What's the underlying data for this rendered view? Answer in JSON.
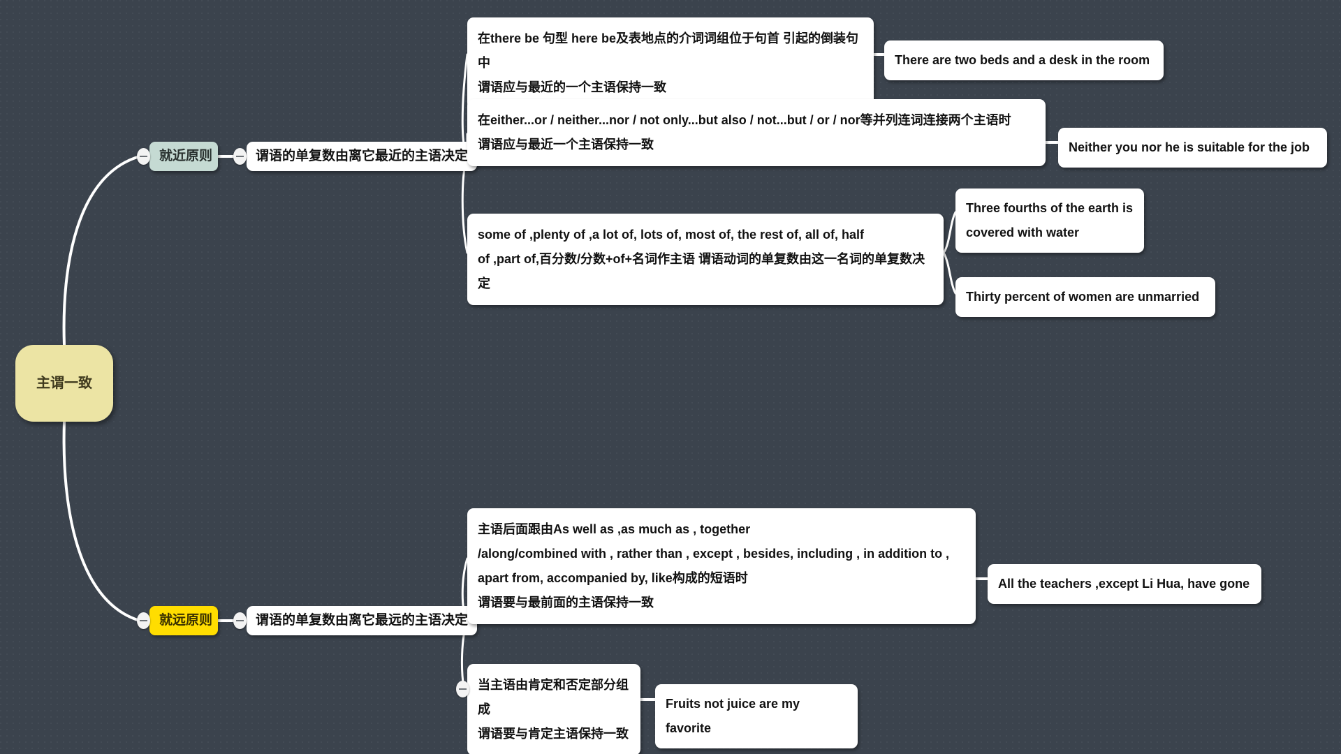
{
  "canvas": {
    "background_color": "#3b434d",
    "edge_color": "#ffffff"
  },
  "root": {
    "label": "主谓一致",
    "fill": "#ece4a4"
  },
  "branches": [
    {
      "label": "就近原则",
      "fill": "#c5dad3",
      "summary": "谓语的单复数由离它最近的主语决定",
      "details": [
        {
          "text": "在there be 句型 here be及表地点的介词词组位于句首 引起的倒装句中\n谓语应与最近的一个主语保持一致",
          "examples": [
            "There are two beds and a desk in the room"
          ]
        },
        {
          "text": "在either...or / neither...nor / not only...but also / not...but / or / nor等并列连词连接两个主语时\n谓语应与最近一个主语保持一致",
          "examples": [
            "Neither you nor he is suitable for the job"
          ]
        },
        {
          "text": "some of ,plenty of ,a lot of, lots of, most of, the rest of, all of, half\nof ,part of,百分数/分数+of+名词作主语 谓语动词的单复数由这一名词的单复数决定",
          "examples": [
            "Three fourths of the earth is\ncovered with water",
            "Thirty percent of women are unmarried"
          ]
        }
      ]
    },
    {
      "label": "就远原则",
      "fill": "#ffdd00",
      "summary": "谓语的单复数由离它最远的主语决定",
      "details": [
        {
          "text": "主语后面跟由As well as ,as much as , together\n/along/combined with , rather than , except , besides, including , in addition to ,\napart from, accompanied by, like构成的短语时\n谓语要与最前面的主语保持一致",
          "examples": [
            "All the teachers ,except Li Hua, have gone"
          ]
        },
        {
          "text": "当主语由肯定和否定部分组成\n谓语要与肯定主语保持一致",
          "examples": [
            "Fruits not juice are my favorite"
          ]
        }
      ]
    }
  ],
  "toggles": {
    "icon": "collapse-minus-icon",
    "count": 5
  }
}
